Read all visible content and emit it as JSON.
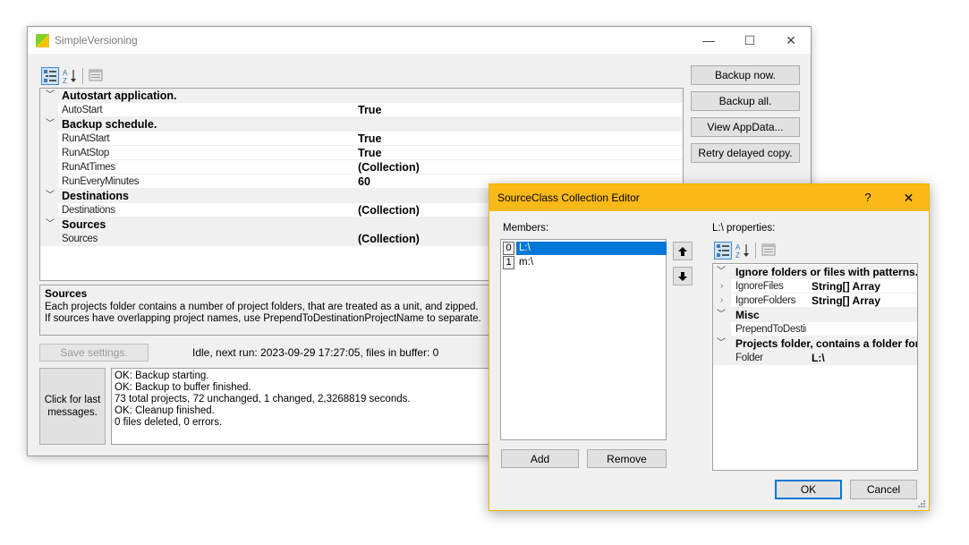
{
  "main_window": {
    "title": "SimpleVersioning",
    "controls": {
      "minimize": "—",
      "maximize": "☐",
      "close": "✕"
    },
    "buttons": {
      "backup_now": "Backup now.",
      "backup_all": "Backup all.",
      "view_appdata": "View AppData...",
      "retry_delayed": "Retry delayed copy."
    },
    "property_grid": {
      "rows": [
        {
          "type": "category",
          "label": "Autostart application."
        },
        {
          "type": "property",
          "name": "AutoStart",
          "value": "True"
        },
        {
          "type": "category",
          "label": "Backup schedule."
        },
        {
          "type": "property",
          "name": "RunAtStart",
          "value": "True"
        },
        {
          "type": "property",
          "name": "RunAtStop",
          "value": "True"
        },
        {
          "type": "property",
          "name": "RunAtTimes",
          "value": "(Collection)"
        },
        {
          "type": "property",
          "name": "RunEveryMinutes",
          "value": "60"
        },
        {
          "type": "category",
          "label": "Destinations"
        },
        {
          "type": "property",
          "name": "Destinations",
          "value": "(Collection)"
        },
        {
          "type": "category",
          "label": "Sources"
        },
        {
          "type": "property",
          "name": "Sources",
          "value": "(Collection)"
        }
      ]
    },
    "description": {
      "title": "Sources",
      "line1": "Each projects folder contains a number of project folders, that are treated as a unit, and zipped.",
      "line2": "If sources have overlapping project names, use PrependToDestinationProjectName to separate."
    },
    "save_settings": "Save settings.",
    "status": "Idle, next run: 2023-09-29 17:27:05, files in buffer: 0",
    "click_last_messages": "Click for last messages.",
    "log_lines": [
      "OK: Backup starting.",
      "OK: Backup to buffer finished.",
      "73 total projects, 72 unchanged, 1 changed, 2,3268819 seconds.",
      "OK: Cleanup finished.",
      "0 files deleted, 0 errors."
    ]
  },
  "dialog": {
    "title": "SourceClass Collection Editor",
    "help": "?",
    "close": "✕",
    "members_label": "Members:",
    "members": [
      {
        "index": "0",
        "label": "L:\\"
      },
      {
        "index": "1",
        "label": "m:\\"
      }
    ],
    "add": "Add",
    "remove": "Remove",
    "properties_label": "L:\\ properties:",
    "rows": [
      {
        "type": "category",
        "label": "Ignore folders or files with patterns."
      },
      {
        "type": "property",
        "name": "IgnoreFiles",
        "value": "String[] Array",
        "expandable": true
      },
      {
        "type": "property",
        "name": "IgnoreFolders",
        "value": "String[] Array",
        "expandable": true
      },
      {
        "type": "category",
        "label": "Misc"
      },
      {
        "type": "property",
        "name": "PrependToDestinationProjectName",
        "value": ""
      },
      {
        "type": "category",
        "label": "Projects folder, contains a folder for each project."
      },
      {
        "type": "property",
        "name": "Folder",
        "value": "L:\\"
      }
    ],
    "ok": "OK",
    "cancel": "Cancel"
  },
  "colors": {
    "dialog_accent": "#fbb917",
    "selection": "#0078d7"
  }
}
